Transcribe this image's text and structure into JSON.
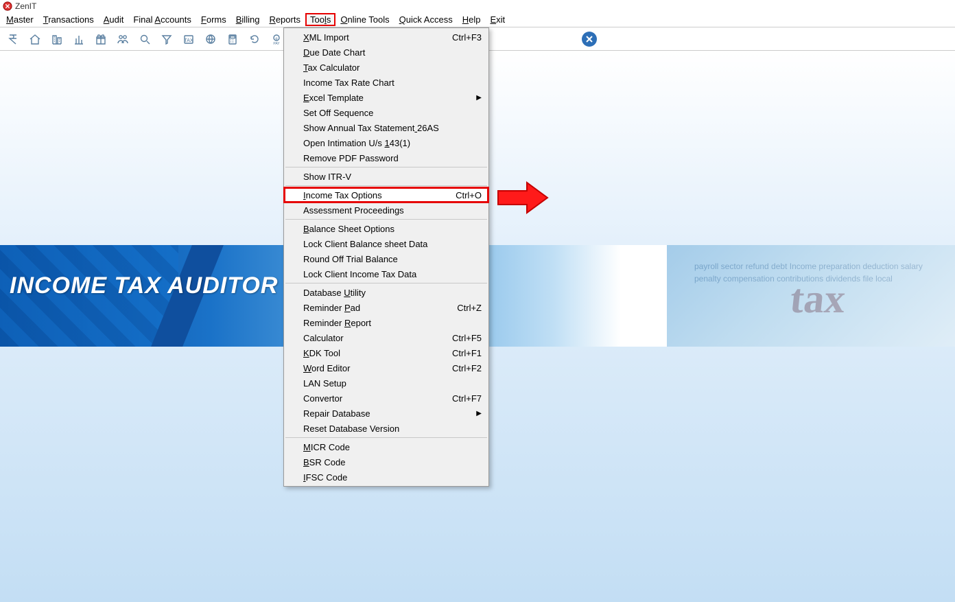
{
  "title": "ZenIT",
  "menubar": [
    {
      "label": "Master",
      "u": 0
    },
    {
      "label": "Transactions",
      "u": 0
    },
    {
      "label": "Audit",
      "u": 0
    },
    {
      "label": "Final Accounts",
      "u": 6
    },
    {
      "label": "Forms",
      "u": 0
    },
    {
      "label": "Billing",
      "u": 0
    },
    {
      "label": "Reports",
      "u": 0
    },
    {
      "label": "Tools",
      "u": 3,
      "active": true
    },
    {
      "label": "Online Tools",
      "u": 0
    },
    {
      "label": "Quick Access",
      "u": 0
    },
    {
      "label": "Help",
      "u": 0
    },
    {
      "label": "Exit",
      "u": 0
    }
  ],
  "toolbar_icons": [
    "rupee-icon",
    "home-icon",
    "buildings-icon",
    "chart-icon",
    "gift-icon",
    "people-icon",
    "search-icon",
    "filter-icon",
    "tax-box-icon",
    "globe-icon",
    "calculator-icon",
    "refresh-icon",
    "epay-icon",
    "form-icon",
    "building2-icon"
  ],
  "banner": {
    "title": "INCOME TAX AUDITOR",
    "tax_word": "tax",
    "cloud": "payroll sector refund debt Income preparation deduction salary penalty compensation contributions dividends file local"
  },
  "dropdown": [
    {
      "t": "item",
      "label": "XML Import",
      "u": 0,
      "shortcut": "Ctrl+F3"
    },
    {
      "t": "item",
      "label": "Due Date Chart",
      "u": 0
    },
    {
      "t": "item",
      "label": "Tax Calculator",
      "u": 0
    },
    {
      "t": "item",
      "label": "Income Tax Rate Chart"
    },
    {
      "t": "item",
      "label": "Excel Template",
      "u": 0,
      "submenu": true
    },
    {
      "t": "item",
      "label": "Set Off Sequence"
    },
    {
      "t": "item",
      "label": "Show Annual Tax Statement 26AS",
      "u": 25
    },
    {
      "t": "item",
      "label": "Open Intimation U/s 143(1)",
      "u": 20
    },
    {
      "t": "item",
      "label": "Remove PDF Password"
    },
    {
      "t": "sep"
    },
    {
      "t": "item",
      "label": "Show ITR-V"
    },
    {
      "t": "sep"
    },
    {
      "t": "item",
      "label": "Income Tax Options",
      "u": 0,
      "shortcut": "Ctrl+O",
      "highlight": true
    },
    {
      "t": "item",
      "label": "Assessment Proceedings"
    },
    {
      "t": "sep"
    },
    {
      "t": "item",
      "label": "Balance Sheet Options",
      "u": 0
    },
    {
      "t": "item",
      "label": "Lock Client Balance sheet Data"
    },
    {
      "t": "item",
      "label": "Round Off Trial Balance"
    },
    {
      "t": "item",
      "label": "Lock Client Income Tax Data"
    },
    {
      "t": "sep"
    },
    {
      "t": "item",
      "label": "Database Utility",
      "u": 9
    },
    {
      "t": "item",
      "label": "Reminder Pad",
      "u": 9,
      "shortcut": "Ctrl+Z"
    },
    {
      "t": "item",
      "label": "Reminder Report",
      "u": 9
    },
    {
      "t": "item",
      "label": "Calculator",
      "shortcut": "Ctrl+F5"
    },
    {
      "t": "item",
      "label": "KDK Tool",
      "u": 0,
      "shortcut": "Ctrl+F1"
    },
    {
      "t": "item",
      "label": "Word Editor",
      "u": 0,
      "shortcut": "Ctrl+F2"
    },
    {
      "t": "item",
      "label": "LAN Setup"
    },
    {
      "t": "item",
      "label": "Convertor",
      "shortcut": "Ctrl+F7"
    },
    {
      "t": "item",
      "label": "Repair Database",
      "u": 15,
      "submenu": true
    },
    {
      "t": "item",
      "label": "Reset Database Version"
    },
    {
      "t": "sep"
    },
    {
      "t": "item",
      "label": "MICR Code",
      "u": 0
    },
    {
      "t": "item",
      "label": "BSR Code",
      "u": 0
    },
    {
      "t": "item",
      "label": "IFSC Code",
      "u": 0
    }
  ]
}
